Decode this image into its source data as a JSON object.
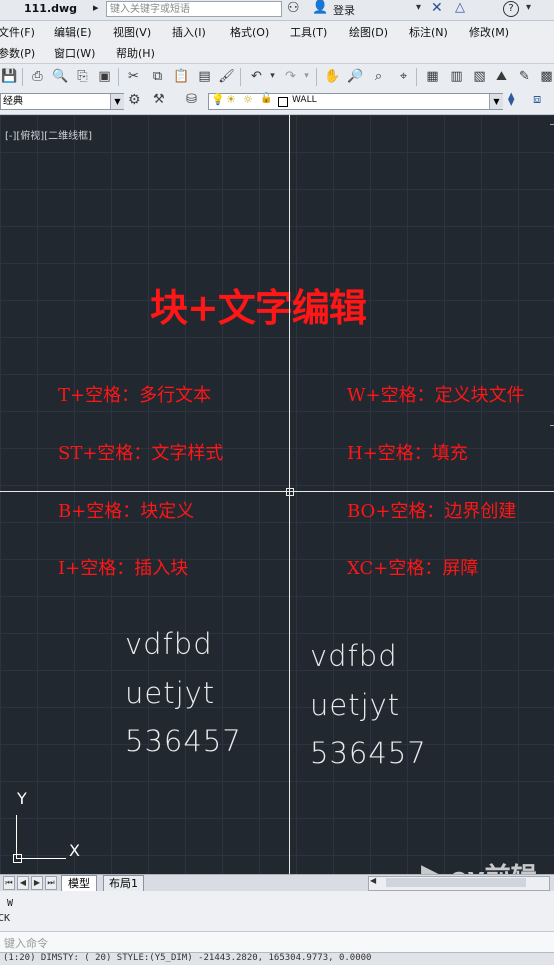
{
  "title_bar": {
    "file_name": "111.dwg",
    "search_placeholder": "键入关键字或短语",
    "login_label": "登录"
  },
  "menu": {
    "row1": [
      "文件(F)",
      "编辑(E)",
      "视图(V)",
      "插入(I)",
      "格式(O)",
      "工具(T)",
      "绘图(D)",
      "标注(N)",
      "修改(M)"
    ],
    "row2": [
      "参数(P)",
      "窗口(W)",
      "帮助(H)"
    ]
  },
  "toolbar2": {
    "workspace": "经典",
    "layer_name": "WALL"
  },
  "canvas": {
    "viewport_label": "[-][俯视][二维线框]",
    "title": "块+文字编辑",
    "commands_left": [
      "T+空格：多行文本",
      "ST+空格：文字样式",
      "B+空格：块定义",
      "I+空格：插入块"
    ],
    "commands_right": [
      "W+空格：定义块文件",
      "H+空格：填充",
      "BO+空格：边界创建",
      "XC+空格：屏障"
    ],
    "text_left": [
      "vdfbd",
      "uetjyt",
      "536457"
    ],
    "text_right": [
      "vdfbd",
      "uetjyt",
      "536457"
    ],
    "ucs": {
      "x": "X",
      "y": "Y"
    },
    "watermark": "ev前辑"
  },
  "tabs": {
    "model": "模型",
    "layout1": "布局1"
  },
  "command_line": {
    "history": [
      "W",
      "CK"
    ],
    "input_placeholder": "键入命令"
  },
  "status_bar": {
    "text": "(1:20) DIMSTY: (  20) STYLE:(Y5_DIM)  -21443.2820, 165304.9773, 0.0000"
  }
}
